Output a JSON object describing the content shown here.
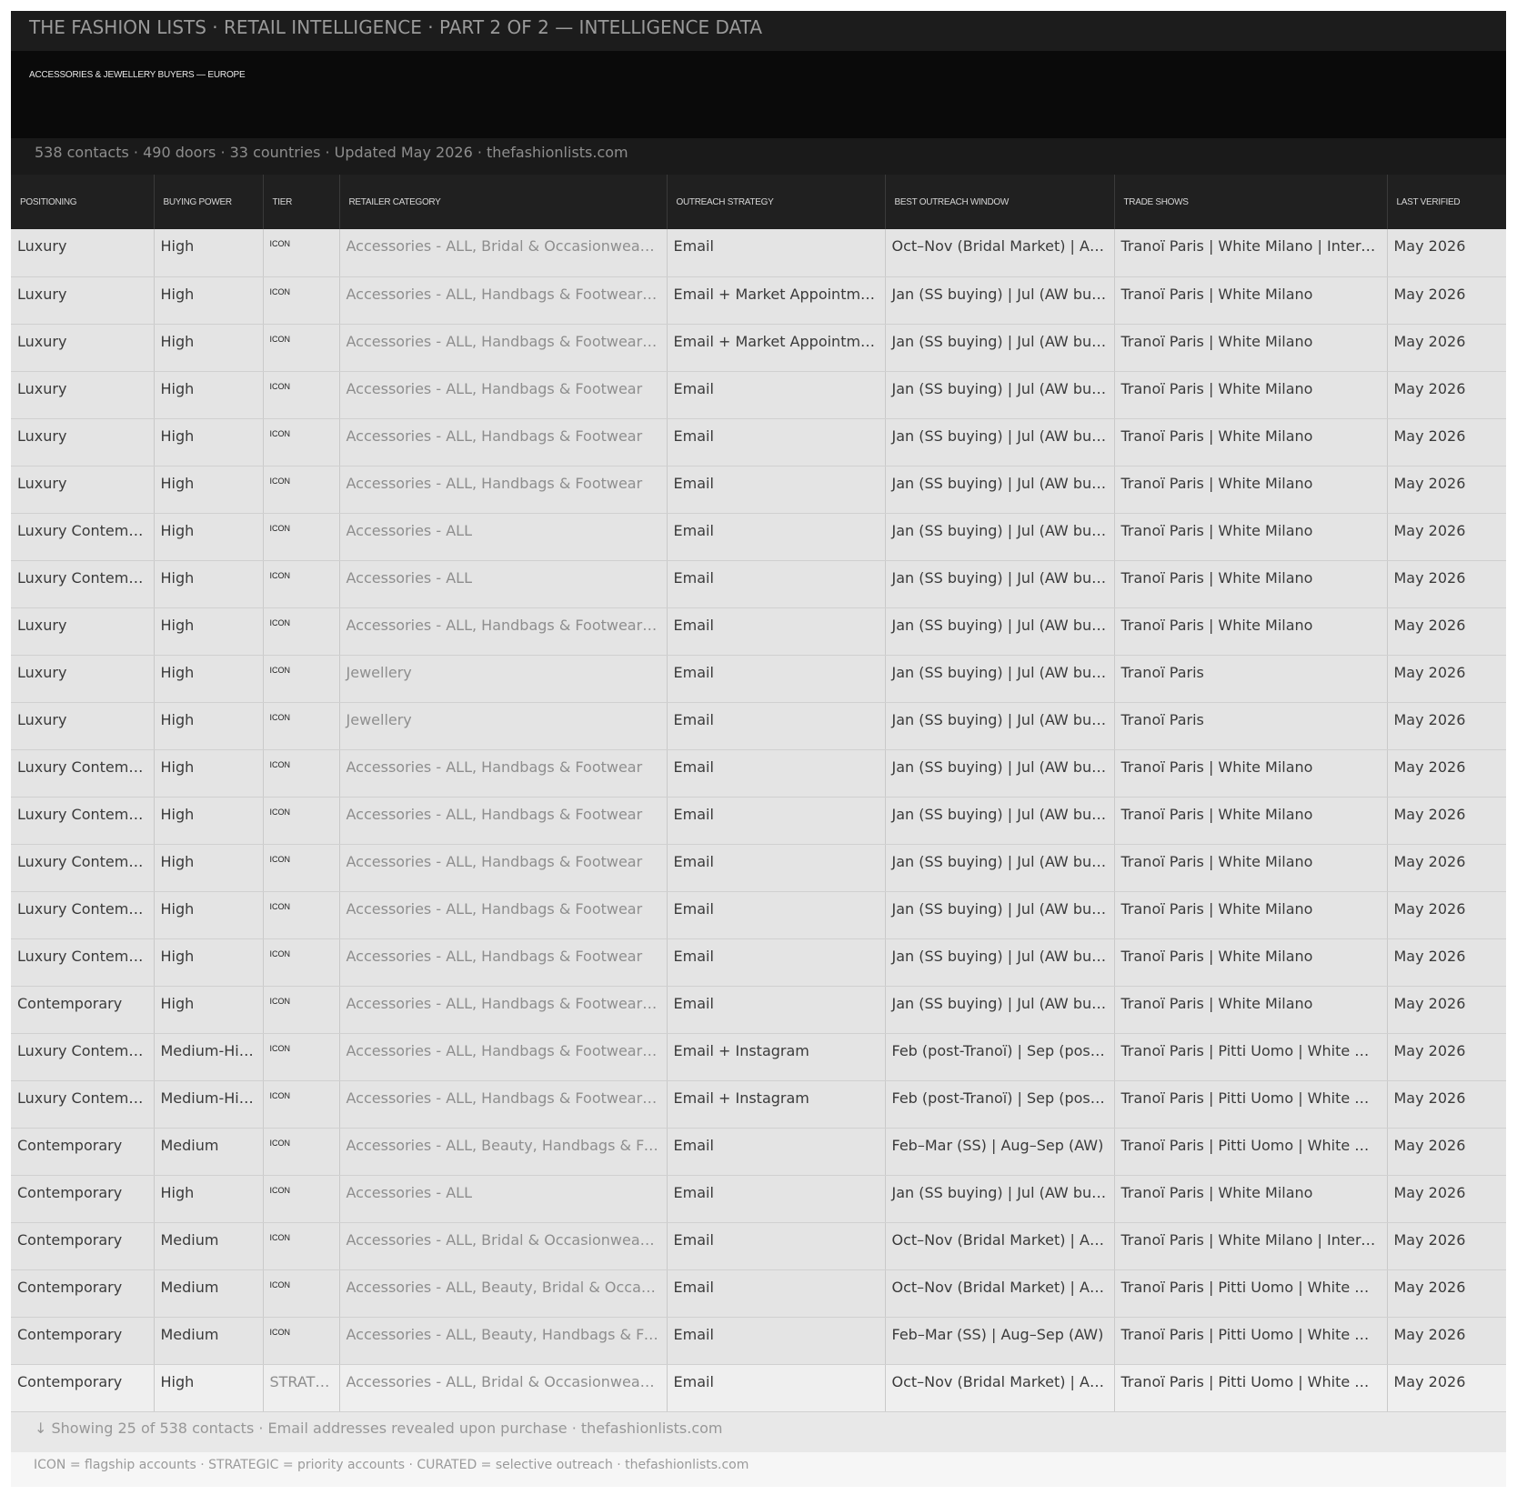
{
  "header": {
    "title": "THE FASHION LISTS  ·  RETAIL INTELLIGENCE  ·  PART 2 OF 2 — INTELLIGENCE DATA",
    "banner": "ACCESSORIES & JEWELLERY BUYERS — EUROPE",
    "stats": "538 contacts  ·  490 doors  ·  33 countries  ·  Updated May 2026  ·  thefashionlists.com"
  },
  "table": {
    "columns": [
      "POSITIONING",
      "BUYING POWER",
      "TIER",
      "RETAILER CATEGORY",
      "OUTREACH STRATEGY",
      "BEST OUTREACH WINDOW",
      "TRADE SHOWS",
      "LAST VERIFIED"
    ],
    "rows": [
      [
        "Luxury",
        "High",
        "ICON",
        "Accessories - ALL, Bridal & Occasionwear, Handbags & Footwear",
        "Email",
        "Oct–Nov (Bridal Market) | Apr–May",
        "Tranoï Paris | White Milano | International Bridal",
        "May 2026"
      ],
      [
        "Luxury",
        "High",
        "ICON",
        "Accessories - ALL, Handbags & Footwear, Jewellery",
        "Email + Market Appointment",
        "Jan (SS buying) | Jul (AW buying)",
        "Tranoï Paris | White Milano",
        "May 2026"
      ],
      [
        "Luxury",
        "High",
        "ICON",
        "Accessories - ALL, Handbags & Footwear, Jewellery",
        "Email + Market Appointment",
        "Jan (SS buying) | Jul (AW buying)",
        "Tranoï Paris | White Milano",
        "May 2026"
      ],
      [
        "Luxury",
        "High",
        "ICON",
        "Accessories - ALL, Handbags & Footwear",
        "Email",
        "Jan (SS buying) | Jul (AW buying)",
        "Tranoï Paris | White Milano",
        "May 2026"
      ],
      [
        "Luxury",
        "High",
        "ICON",
        "Accessories - ALL, Handbags & Footwear",
        "Email",
        "Jan (SS buying) | Jul (AW buying)",
        "Tranoï Paris | White Milano",
        "May 2026"
      ],
      [
        "Luxury",
        "High",
        "ICON",
        "Accessories - ALL, Handbags & Footwear",
        "Email",
        "Jan (SS buying) | Jul (AW buying)",
        "Tranoï Paris | White Milano",
        "May 2026"
      ],
      [
        "Luxury Contemporary",
        "High",
        "ICON",
        "Accessories - ALL",
        "Email",
        "Jan (SS buying) | Jul (AW buying)",
        "Tranoï Paris | White Milano",
        "May 2026"
      ],
      [
        "Luxury Contemporary",
        "High",
        "ICON",
        "Accessories - ALL",
        "Email",
        "Jan (SS buying) | Jul (AW buying)",
        "Tranoï Paris | White Milano",
        "May 2026"
      ],
      [
        "Luxury",
        "High",
        "ICON",
        "Accessories - ALL, Handbags & Footwear, Jewellery",
        "Email",
        "Jan (SS buying) | Jul (AW buying)",
        "Tranoï Paris | White Milano",
        "May 2026"
      ],
      [
        "Luxury",
        "High",
        "ICON",
        "Jewellery",
        "Email",
        "Jan (SS buying) | Jul (AW buying)",
        "Tranoï Paris",
        "May 2026"
      ],
      [
        "Luxury",
        "High",
        "ICON",
        "Jewellery",
        "Email",
        "Jan (SS buying) | Jul (AW buying)",
        "Tranoï Paris",
        "May 2026"
      ],
      [
        "Luxury Contemporary",
        "High",
        "ICON",
        "Accessories - ALL, Handbags & Footwear",
        "Email",
        "Jan (SS buying) | Jul (AW buying)",
        "Tranoï Paris | White Milano",
        "May 2026"
      ],
      [
        "Luxury Contemporary",
        "High",
        "ICON",
        "Accessories - ALL, Handbags & Footwear",
        "Email",
        "Jan (SS buying) | Jul (AW buying)",
        "Tranoï Paris | White Milano",
        "May 2026"
      ],
      [
        "Luxury Contemporary",
        "High",
        "ICON",
        "Accessories - ALL, Handbags & Footwear",
        "Email",
        "Jan (SS buying) | Jul (AW buying)",
        "Tranoï Paris | White Milano",
        "May 2026"
      ],
      [
        "Luxury Contemporary",
        "High",
        "ICON",
        "Accessories - ALL, Handbags & Footwear",
        "Email",
        "Jan (SS buying) | Jul (AW buying)",
        "Tranoï Paris | White Milano",
        "May 2026"
      ],
      [
        "Luxury Contemporary",
        "High",
        "ICON",
        "Accessories - ALL, Handbags & Footwear",
        "Email",
        "Jan (SS buying) | Jul (AW buying)",
        "Tranoï Paris | White Milano",
        "May 2026"
      ],
      [
        "Contemporary",
        "High",
        "ICON",
        "Accessories - ALL, Handbags & Footwear, Jewellery",
        "Email",
        "Jan (SS buying) | Jul (AW buying)",
        "Tranoï Paris | White Milano",
        "May 2026"
      ],
      [
        "Luxury Contemporary",
        "Medium-High",
        "ICON",
        "Accessories - ALL, Handbags & Footwear, Jewellery",
        "Email + Instagram",
        "Feb (post-Tranoï) | Sep (post-Tranoï)",
        "Tranoï Paris | Pitti Uomo | White Milano",
        "May 2026"
      ],
      [
        "Luxury Contemporary",
        "Medium-High",
        "ICON",
        "Accessories - ALL, Handbags & Footwear, Jewellery",
        "Email + Instagram",
        "Feb (post-Tranoï) | Sep (post-Tranoï)",
        "Tranoï Paris | Pitti Uomo | White Milano",
        "May 2026"
      ],
      [
        "Contemporary",
        "Medium",
        "ICON",
        "Accessories - ALL, Beauty, Handbags & Footwear",
        "Email",
        "Feb–Mar (SS) | Aug–Sep (AW)",
        "Tranoï Paris | Pitti Uomo | White Milano",
        "May 2026"
      ],
      [
        "Contemporary",
        "High",
        "ICON",
        "Accessories - ALL",
        "Email",
        "Jan (SS buying) | Jul (AW buying)",
        "Tranoï Paris | White Milano",
        "May 2026"
      ],
      [
        "Contemporary",
        "Medium",
        "ICON",
        "Accessories - ALL, Bridal & Occasionwear, Handbags & Footwear",
        "Email",
        "Oct–Nov (Bridal Market) | Apr–May",
        "Tranoï Paris | White Milano | International Bridal",
        "May 2026"
      ],
      [
        "Contemporary",
        "Medium",
        "ICON",
        "Accessories - ALL, Beauty, Bridal & Occasionwear",
        "Email",
        "Oct–Nov (Bridal Market) | Apr–May",
        "Tranoï Paris | Pitti Uomo | White Milano",
        "May 2026"
      ],
      [
        "Contemporary",
        "Medium",
        "ICON",
        "Accessories - ALL, Beauty, Handbags & Footwear",
        "Email",
        "Feb–Mar (SS) | Aug–Sep (AW)",
        "Tranoï Paris | Pitti Uomo | White Milano",
        "May 2026"
      ],
      [
        "Contemporary",
        "High",
        "STRATEGIC",
        "Accessories - ALL, Bridal & Occasionwear, Handbags & Footwear",
        "Email",
        "Oct–Nov (Bridal Market) | Apr–May",
        "Tranoï Paris | Pitti Uomo | White Milano",
        "May 2026"
      ]
    ]
  },
  "footer": {
    "showing": "↓  Showing 25 of 538 contacts  ·  Email addresses revealed upon purchase  ·  thefashionlists.com",
    "legend": "ICON = flagship accounts  ·  STRATEGIC = priority accounts  ·  CURATED = selective outreach  ·  thefashionlists.com"
  }
}
